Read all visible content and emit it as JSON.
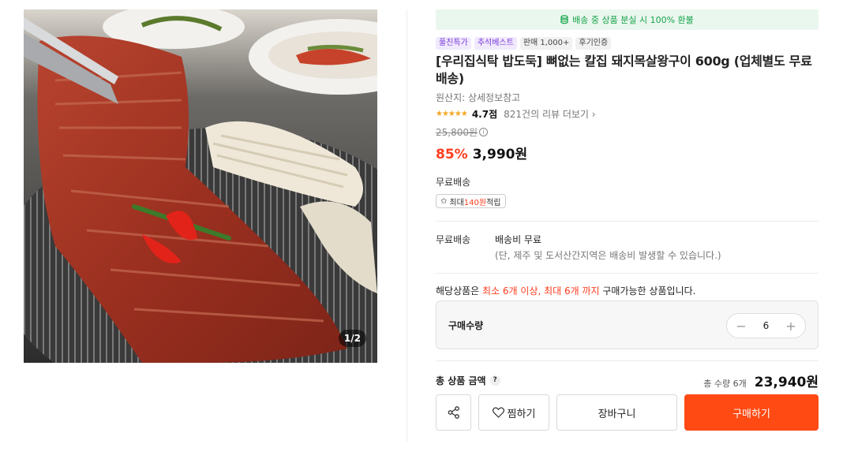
{
  "gallery": {
    "counter": "1/2"
  },
  "banner": {
    "icon": "coin-stack-icon",
    "text": "배송 중 상품 분실 시 100% 환불"
  },
  "badges": [
    {
      "label": "풀친특가",
      "color": "#7a3fd8"
    },
    {
      "label": "추석베스트",
      "color": "#7a3fd8"
    },
    {
      "label": "판매 1,000+",
      "color": "#444444"
    },
    {
      "label": "후기인증",
      "color": "#444444"
    }
  ],
  "product": {
    "title": "[우리집식탁 밥도둑] 뼈없는 칼집 돼지목살왕구이 600g (업체별도 무료배송)",
    "origin": "원산지: 상세정보참고",
    "stars": "★★★★★",
    "rating": "4.7점",
    "reviews": "821건의 리뷰 더보기",
    "original_price": "25,800원",
    "discount": "85%",
    "price": "3,990원"
  },
  "shipping": {
    "label": "무료배송",
    "point_prefix": "최대 ",
    "point_amount": "140원",
    "point_suffix": " 적립",
    "info_key": "무료배송",
    "info_value": "배송비 무료",
    "info_note": "(단, 제주 및 도서산간지역은 배송비 발생할 수 있습니다.)"
  },
  "limit": {
    "prefix": "해당상품은 ",
    "highlight": "최소 6개 이상, 최대 6개 까지",
    "suffix": " 구매가능한 상품입니다."
  },
  "quantity": {
    "label": "구매수량",
    "value": "6",
    "minus": "−",
    "plus": "+"
  },
  "total": {
    "label": "총 상품 금액",
    "help": "?",
    "count": "총 수량 6개",
    "price": "23,940원"
  },
  "actions": {
    "wish": "찜하기",
    "cart": "장바구니",
    "buy": "구매하기"
  },
  "colors": {
    "accent": "#ff4a14",
    "discount": "#ff3d1f",
    "banner_text": "#17a34a",
    "star": "#f5a623"
  }
}
